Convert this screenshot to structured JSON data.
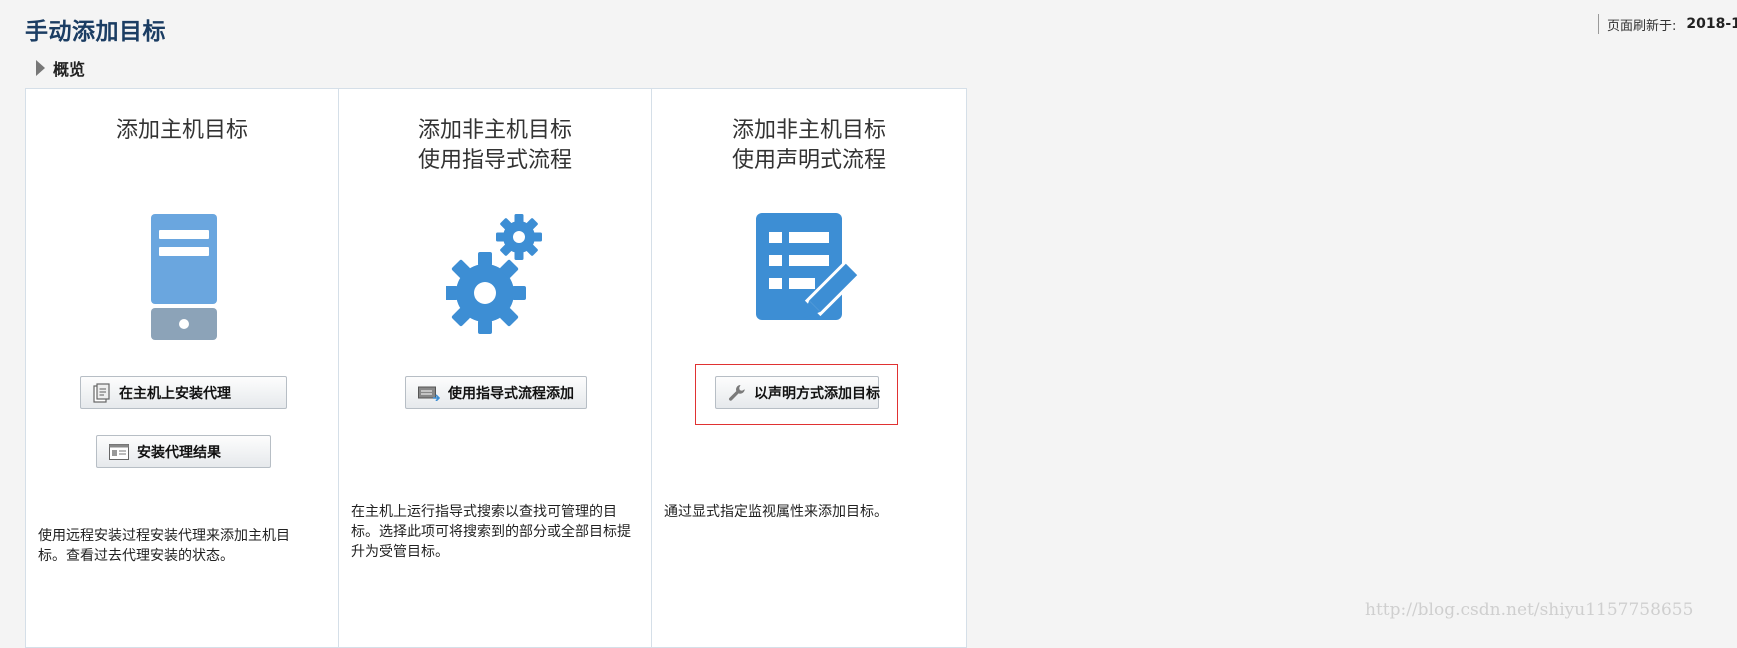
{
  "page": {
    "title": "手动添加目标",
    "refresh_label": "页面刷新于:",
    "refresh_value": "2018-1"
  },
  "overview": {
    "label": "概览",
    "icon": "collapse-triangle-icon"
  },
  "panels": [
    {
      "title_lines": [
        "添加主机目标"
      ],
      "illustration_icon": "server-icon",
      "buttons": [
        {
          "label": "在主机上安装代理",
          "icon": "install-agent-icon"
        },
        {
          "label": "安装代理结果",
          "icon": "results-icon"
        }
      ],
      "description": "使用远程安装过程安装代理来添加主机目标。查看过去代理安装的状态。"
    },
    {
      "title_lines": [
        "添加非主机目标",
        "使用指导式流程"
      ],
      "illustration_icon": "gears-icon",
      "buttons": [
        {
          "label": "使用指导式流程添加",
          "icon": "guided-add-icon"
        }
      ],
      "description": "在主机上运行指导式搜索以查找可管理的目标。选择此项可将搜索到的部分或全部目标提升为受管目标。"
    },
    {
      "title_lines": [
        "添加非主机目标",
        "使用声明式流程"
      ],
      "illustration_icon": "form-edit-icon",
      "buttons": [
        {
          "label": "以声明方式添加目标",
          "icon": "wrench-icon"
        }
      ],
      "description": "通过显式指定监视属性来添加目标。"
    }
  ],
  "colors": {
    "title": "#1b3d63",
    "panel_border": "#d5dfe8",
    "icon_blue": "#3d8ed4",
    "highlight": "#e03232"
  },
  "watermark": "http://blog.csdn.net/shiyu1157758655"
}
